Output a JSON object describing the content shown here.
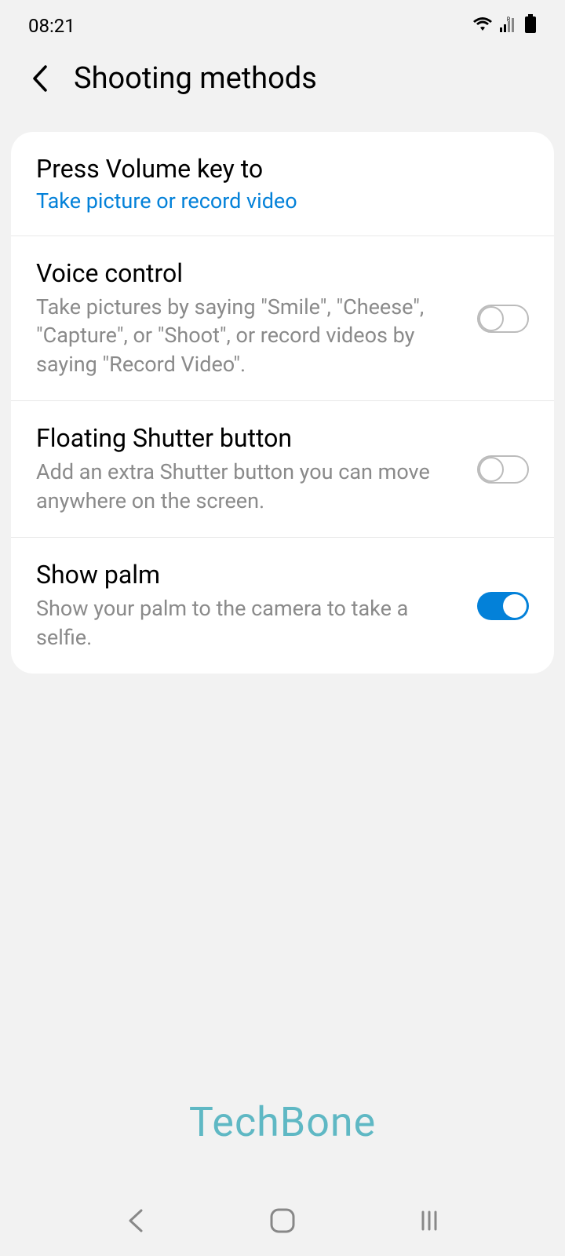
{
  "statusBar": {
    "time": "08:21"
  },
  "header": {
    "title": "Shooting methods"
  },
  "settings": [
    {
      "title": "Press Volume key to",
      "value": "Take picture or record video",
      "hasToggle": false
    },
    {
      "title": "Voice control",
      "desc": "Take pictures by saying \"Smile\", \"Cheese\", \"Capture\", or \"Shoot\", or record videos by saying \"Record Video\".",
      "toggleOn": false
    },
    {
      "title": "Floating Shutter button",
      "desc": "Add an extra Shutter button you can move anywhere on the screen.",
      "toggleOn": false
    },
    {
      "title": "Show palm",
      "desc": "Show your palm to the camera to take a selfie.",
      "toggleOn": true
    }
  ],
  "watermark": "TechBone"
}
